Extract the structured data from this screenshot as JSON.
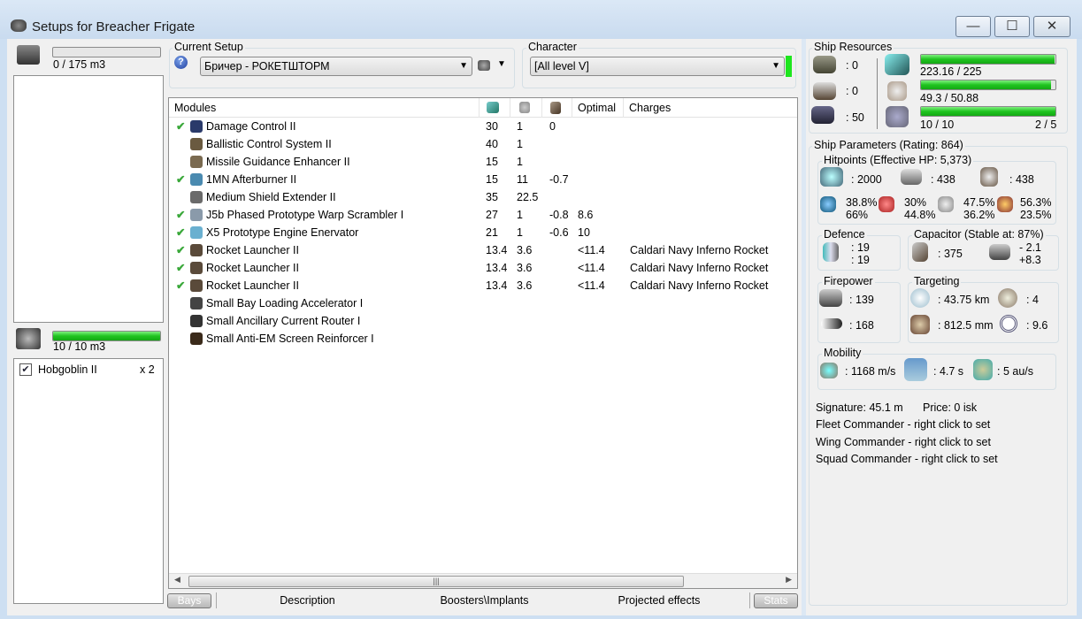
{
  "window": {
    "title": "Setups for Breacher Frigate",
    "minimize": "—",
    "maximize": "☐",
    "close": "✕"
  },
  "cargo": {
    "used_text": "0 / 175 m3",
    "fill": 0
  },
  "drone_bay": {
    "used_text": "10 / 10 m3",
    "fill": 1.0,
    "drones": [
      {
        "name": "Hobgoblin II",
        "qty": "x 2",
        "checked": true
      }
    ]
  },
  "setup": {
    "label": "Current Setup",
    "value": "Бричер - РОКЕТШТОРМ",
    "help": "?"
  },
  "character": {
    "label": "Character",
    "value": "[All level V]"
  },
  "modules": {
    "headers": {
      "name": "Modules",
      "optimal": "Optimal",
      "charges": "Charges"
    },
    "rows": [
      {
        "active": true,
        "name": "Damage Control II",
        "cpu": "30",
        "pg": "1",
        "cap": "0",
        "optimal": "",
        "charges": "",
        "color": "#2a3a6a"
      },
      {
        "active": false,
        "name": "Ballistic Control System II",
        "cpu": "40",
        "pg": "1",
        "cap": "",
        "optimal": "",
        "charges": "",
        "color": "#6a5a40"
      },
      {
        "active": false,
        "name": "Missile Guidance Enhancer II",
        "cpu": "15",
        "pg": "1",
        "cap": "",
        "optimal": "",
        "charges": "",
        "color": "#7a6a50"
      },
      {
        "active": true,
        "name": "1MN Afterburner II",
        "cpu": "15",
        "pg": "11",
        "cap": "-0.7",
        "optimal": "",
        "charges": "",
        "color": "#4a8ab0"
      },
      {
        "active": false,
        "name": "Medium Shield Extender II",
        "cpu": "35",
        "pg": "22.5",
        "cap": "",
        "optimal": "",
        "charges": "",
        "color": "#6a6a6a"
      },
      {
        "active": true,
        "name": "J5b Phased Prototype Warp Scrambler I",
        "cpu": "27",
        "pg": "1",
        "cap": "-0.8",
        "optimal": "8.6",
        "charges": "",
        "color": "#8a9aaa"
      },
      {
        "active": true,
        "name": "X5 Prototype Engine Enervator",
        "cpu": "21",
        "pg": "1",
        "cap": "-0.6",
        "optimal": "10",
        "charges": "",
        "color": "#6ab0d0"
      },
      {
        "active": true,
        "name": "Rocket Launcher II",
        "cpu": "13.4",
        "pg": "3.6",
        "cap": "",
        "optimal": "<11.4",
        "charges": "Caldari Navy Inferno Rocket",
        "color": "#5a4a3a"
      },
      {
        "active": true,
        "name": "Rocket Launcher II",
        "cpu": "13.4",
        "pg": "3.6",
        "cap": "",
        "optimal": "<11.4",
        "charges": "Caldari Navy Inferno Rocket",
        "color": "#5a4a3a"
      },
      {
        "active": true,
        "name": "Rocket Launcher II",
        "cpu": "13.4",
        "pg": "3.6",
        "cap": "",
        "optimal": "<11.4",
        "charges": "Caldari Navy Inferno Rocket",
        "color": "#5a4a3a"
      },
      {
        "active": false,
        "name": "Small Bay Loading Accelerator I",
        "cpu": "",
        "pg": "",
        "cap": "",
        "optimal": "",
        "charges": "",
        "color": "#444"
      },
      {
        "active": false,
        "name": "Small Ancillary Current Router I",
        "cpu": "",
        "pg": "",
        "cap": "",
        "optimal": "",
        "charges": "",
        "color": "#333"
      },
      {
        "active": false,
        "name": "Small Anti-EM Screen Reinforcer I",
        "cpu": "",
        "pg": "",
        "cap": "",
        "optimal": "",
        "charges": "",
        "color": "#3a2a1a"
      }
    ]
  },
  "tabs": {
    "bays": "Bays",
    "description": "Description",
    "boosters": "Boosters\\Implants",
    "projected": "Projected effects",
    "stats": "Stats"
  },
  "resources": {
    "label": "Ship Resources",
    "turrets": ": 0",
    "launchers_hard": ": 0",
    "calibration": ": 50",
    "cpu_text": "223.16 / 225",
    "cpu_fill": 0.992,
    "pg_text": "49.3 / 50.88",
    "pg_fill": 0.969,
    "drone_bw_text": "10 / 10",
    "drone_bw_fill": 1.0,
    "drones_active": "2 / 5"
  },
  "params": {
    "label": "Ship Parameters (Rating: 864)",
    "hp": {
      "label": "Hitpoints (Effective HP: 5,373)",
      "shield": ": 2000",
      "armor": ": 438",
      "structure": ": 438",
      "em": [
        "38.8%",
        "66%"
      ],
      "thermal": [
        "30%",
        "44.8%"
      ],
      "kinetic": [
        "47.5%",
        "36.2%"
      ],
      "explosive": [
        "56.3%",
        "23.5%"
      ]
    },
    "defence": {
      "label": "Defence",
      "a": ": 19",
      "b": ": 19"
    },
    "capacitor": {
      "label": "Capacitor (Stable at: 87%)",
      "capacity": ": 375",
      "use": "- 2.1",
      "recharge": "+8.3"
    },
    "firepower": {
      "label": "Firepower",
      "turret": ": 139",
      "missile": ": 168"
    },
    "targeting": {
      "label": "Targeting",
      "range": ": 43.75 km",
      "targets": ": 4",
      "scan": ": 812.5 mm",
      "sensor": ": 9.6"
    },
    "mobility": {
      "label": "Mobility",
      "speed": ": 1168 m/s",
      "align": ": 4.7 s",
      "warp": ": 5 au/s"
    },
    "signature": "Signature: 45.1 m",
    "price": "Price: 0 isk",
    "fleet": "Fleet Commander - right click to set",
    "wing": "Wing Commander - right click to set",
    "squad": "Squad Commander - right click to set"
  }
}
